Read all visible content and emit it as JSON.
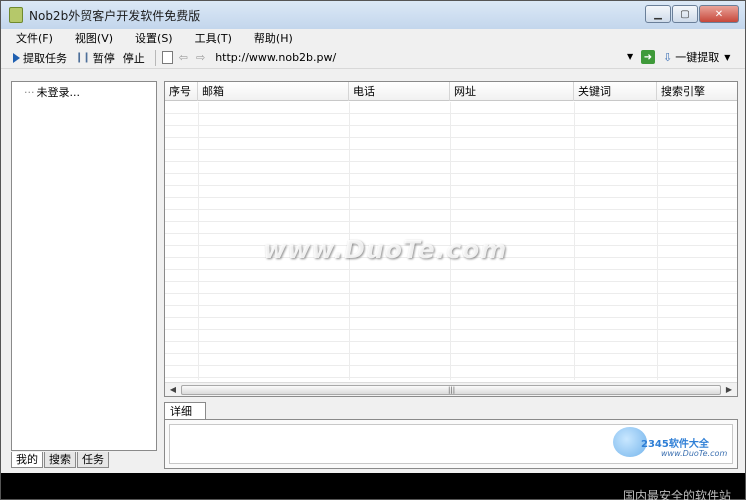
{
  "window": {
    "title": "Nob2b外贸客户开发软件免费版"
  },
  "menu": {
    "items": [
      {
        "label": "文件(F)"
      },
      {
        "label": "视图(V)"
      },
      {
        "label": "设置(S)"
      },
      {
        "label": "工具(T)"
      },
      {
        "label": "帮助(H)"
      }
    ]
  },
  "toolbar": {
    "extract_task_label": "提取任务",
    "pause_label": "暂停",
    "stop_label": "停止",
    "url_value": "http://www.nob2b.pw/",
    "one_click_extract_label": "一键提取"
  },
  "left_panel": {
    "tree_item": "未登录...",
    "tabs": [
      {
        "label": "我的"
      },
      {
        "label": "搜索"
      },
      {
        "label": "任务"
      }
    ]
  },
  "grid": {
    "columns": [
      {
        "label": "序号"
      },
      {
        "label": "邮箱"
      },
      {
        "label": "电话"
      },
      {
        "label": "网址"
      },
      {
        "label": "关键词"
      },
      {
        "label": "搜索引擎"
      }
    ],
    "rows": []
  },
  "detail": {
    "tab_label": "详细"
  },
  "watermark": {
    "center": "www.DuoTe.com",
    "brand": "2345软件大全",
    "url": "www.DuoTe.com",
    "sub": "国内最安全的软件站"
  }
}
